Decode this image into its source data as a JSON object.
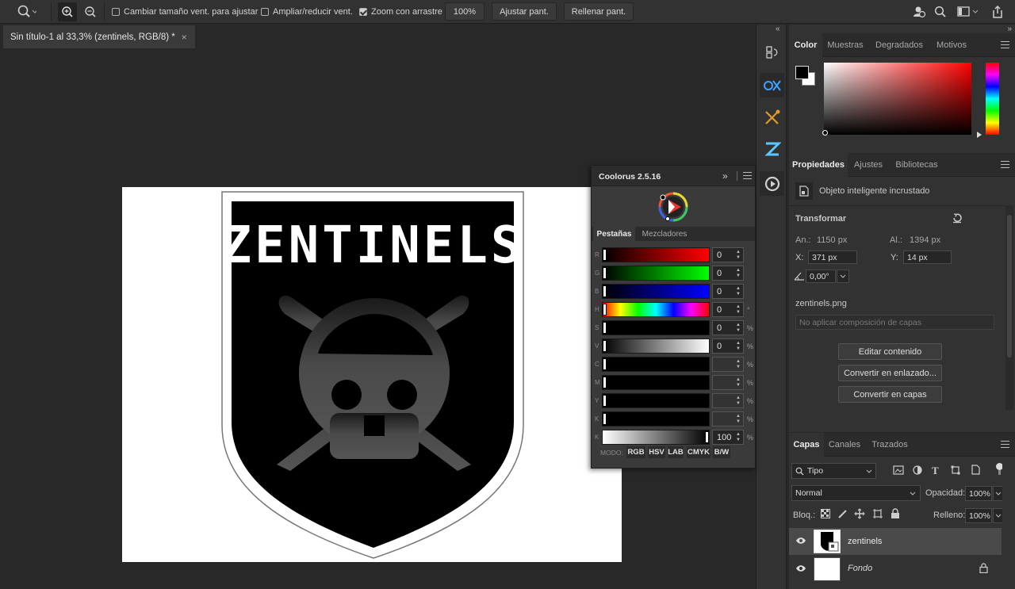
{
  "options_bar": {
    "resize_windows_label": "Cambiar tamaño vent. para ajustar",
    "resize_windows_checked": false,
    "zoom_all_windows_label": "Ampliar/reducir vent.",
    "zoom_all_windows_checked": false,
    "scrubby_zoom_label": "Zoom con arrastre",
    "scrubby_zoom_checked": true,
    "zoom_percent_button": "100%",
    "fit_screen_button": "Ajustar pant.",
    "fill_screen_button": "Rellenar pant."
  },
  "document": {
    "tab_title": "Sin título-1 al 33,3% (zentinels, RGB/8) *",
    "close_glyph": "×",
    "logo_text": "ZENTINELS"
  },
  "color_panel": {
    "tabs": [
      "Color",
      "Muestras",
      "Degradados",
      "Motivos"
    ],
    "active_tab": 0,
    "foreground": "#000000",
    "background": "#ffffff"
  },
  "properties_panel": {
    "tabs": [
      "Propiedades",
      "Ajustes",
      "Bibliotecas"
    ],
    "active_tab": 0,
    "object_type": "Objeto inteligente incrustado",
    "transform_title": "Transformar",
    "width_label": "An.:",
    "width_value": "1150 px",
    "height_label": "Al.:",
    "height_value": "1394 px",
    "x_label": "X:",
    "x_value": "371 px",
    "y_label": "Y:",
    "y_value": "14 px",
    "angle_value": "0,00°",
    "file_name": "zentinels.png",
    "layer_comp_placeholder": "No aplicar composición de capas",
    "edit_contents_button": "Editar contenido",
    "convert_linked_button": "Convertir en enlazado...",
    "convert_layers_button": "Convertir en capas"
  },
  "coolorus": {
    "title": "Coolorus 2.5.16",
    "tabs": [
      "Pestañas",
      "Mezcladores"
    ],
    "active_tab": 0,
    "rows": [
      {
        "label": "R",
        "value": "0",
        "unit": ""
      },
      {
        "label": "G",
        "value": "0",
        "unit": ""
      },
      {
        "label": "B",
        "value": "0",
        "unit": ""
      },
      {
        "label": "H",
        "value": "0",
        "unit": "°"
      },
      {
        "label": "S",
        "value": "0",
        "unit": "%"
      },
      {
        "label": "V",
        "value": "0",
        "unit": "%"
      },
      {
        "label": "C",
        "value": "",
        "unit": "%"
      },
      {
        "label": "M",
        "value": "",
        "unit": "%"
      },
      {
        "label": "Y",
        "value": "",
        "unit": "%"
      },
      {
        "label": "K",
        "value": "",
        "unit": "%"
      },
      {
        "label": "K",
        "value": "100",
        "unit": "%"
      }
    ],
    "mode_label": "MODO:",
    "modes": [
      "RGB",
      "HSV",
      "LAB",
      "CMYK",
      "B/W"
    ]
  },
  "layers_panel": {
    "tabs": [
      "Capas",
      "Canales",
      "Trazados"
    ],
    "active_tab": 0,
    "filter_kind": "Tipo",
    "blend_mode": "Normal",
    "opacity_label": "Opacidad:",
    "opacity_value": "100%",
    "lock_label": "Bloq.:",
    "fill_label": "Relleno:",
    "fill_value": "100%",
    "layers": [
      {
        "name": "zentinels",
        "visible": true,
        "selected": true,
        "locked": false
      },
      {
        "name": "Fondo",
        "visible": true,
        "selected": false,
        "locked": true
      }
    ]
  },
  "colors": {
    "accent": "#1473e6",
    "panel_bg": "#323232",
    "canvas_bg": "#282828"
  }
}
